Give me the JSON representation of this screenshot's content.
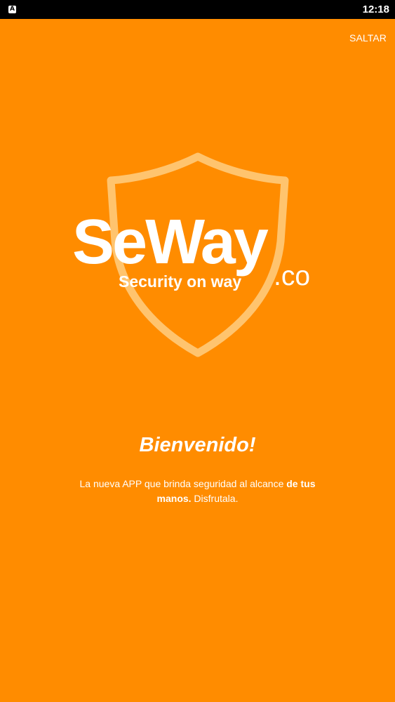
{
  "status_bar": {
    "app_icon_glyph": "A",
    "time": "12:18"
  },
  "header": {
    "skip_label": "SALTAR"
  },
  "logo": {
    "brand": "SeWay",
    "tagline": "Security on way",
    "domain": ".co",
    "watermark_icon": "shield-icon"
  },
  "welcome": {
    "title": "Bienvenido!",
    "message_part_1": "La nueva APP que brinda seguridad al alcance ",
    "message_emphasis": "de tus manos.",
    "message_part_2": " Disfrutala."
  },
  "colors": {
    "background": "#ff8c00",
    "status_bar": "#000000",
    "text": "#ffffff",
    "shield_watermark": "#ffc46e"
  }
}
